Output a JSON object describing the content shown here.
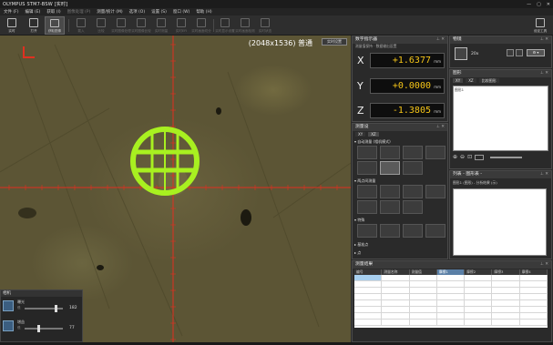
{
  "window": {
    "title": "OLYMPUS STM7-BSW [实时]",
    "controls": [
      "—",
      "▢",
      "✕"
    ]
  },
  "menu": [
    {
      "label": "文件 (F)",
      "enabled": true
    },
    {
      "label": "编辑 (E)",
      "enabled": true
    },
    {
      "label": "获取 (I)",
      "enabled": true
    },
    {
      "label": "图像处理 (P)",
      "enabled": false
    },
    {
      "label": "测量/统计 (M)",
      "enabled": true
    },
    {
      "label": "选项 (O)",
      "enabled": true
    },
    {
      "label": "设置 (S)",
      "enabled": true
    },
    {
      "label": "窗口 (W)",
      "enabled": true
    },
    {
      "label": "帮助 (H)",
      "enabled": true
    }
  ],
  "toolbar": {
    "buttons": [
      {
        "label": "实时",
        "enabled": true
      },
      {
        "label": "打开",
        "enabled": true
      },
      {
        "label": "获取图像",
        "enabled": true,
        "selected": true
      },
      {
        "label": "载入",
        "enabled": false
      },
      {
        "label": "比较",
        "enabled": false
      },
      {
        "label": "实时图像处理",
        "enabled": false
      },
      {
        "label": "实时图像比较",
        "enabled": false
      },
      {
        "label": "实时测量",
        "enabled": false
      },
      {
        "label": "实时EFI",
        "enabled": false
      },
      {
        "label": "实时画面切分",
        "enabled": false
      },
      {
        "label": "实时显示设置",
        "enabled": false
      },
      {
        "label": "实时画面检测",
        "enabled": false
      },
      {
        "label": "实时状态",
        "enabled": false
      },
      {
        "label": "设定工具",
        "enabled": true
      }
    ]
  },
  "live": {
    "resolution": "(2048x1536) 普通",
    "button": "实时设置",
    "crosshair_color": "#e03020",
    "reticle_color": "#a8f020"
  },
  "camera_control": {
    "title": "相机",
    "rows": [
      {
        "label": "曝光",
        "sub": "低",
        "value": "182",
        "level": 0.82
      },
      {
        "label": "增益",
        "sub": "低",
        "value": "77",
        "level": 0.35
      }
    ]
  },
  "dro": {
    "title": "数字指示器",
    "sub": "测量值保持 · 数据输出设置",
    "axes": [
      {
        "axis": "X",
        "value": "+1.6377",
        "unit": "mm"
      },
      {
        "axis": "Y",
        "value": "+0.0000",
        "unit": "mm"
      },
      {
        "axis": "Z",
        "value": "-1.3805",
        "unit": "mm"
      }
    ],
    "value_color": "#f5c518"
  },
  "objective": {
    "title": "物镜",
    "label": "20x"
  },
  "shape": {
    "title": "图形",
    "tabs": [
      "XY",
      "XZ",
      "比较图形"
    ],
    "text": "图形1"
  },
  "measure": {
    "title": "测量设",
    "tabs": [
      "XY",
      "XZ"
    ],
    "sections": [
      "自动测量 (相机模式)",
      "两点间测量",
      "特殊",
      "基准点",
      "点"
    ]
  },
  "list": {
    "title": "列表 - 图形表 -",
    "row": "图形1 (图形) - 分析结果 (示)"
  },
  "results": {
    "title": "测量结果",
    "columns": [
      "编号",
      "测量名称",
      "测量值",
      "摩擦1",
      "摩擦2",
      "摩擦3",
      "摩擦4"
    ],
    "highlight_column": 3,
    "row_count": 8
  }
}
